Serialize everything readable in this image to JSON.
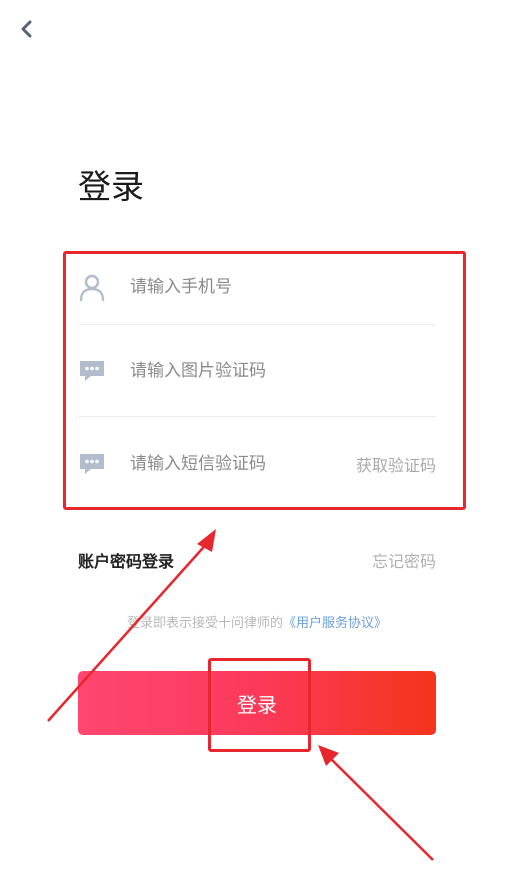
{
  "colors": {
    "accent_start": "#ff4670",
    "accent_end": "#f5341c",
    "annotation": "#e8262d",
    "link": "#6a9fe0"
  },
  "header": {
    "back_icon": "chevron-left-icon"
  },
  "title": "登录",
  "form": {
    "phone": {
      "placeholder": "请输入手机号",
      "icon": "user-icon"
    },
    "image_code": {
      "placeholder": "请输入图片验证码",
      "icon": "chat-icon"
    },
    "sms_code": {
      "placeholder": "请输入短信验证码",
      "icon": "chat-icon",
      "action": "获取验证码"
    }
  },
  "links": {
    "password_login": "账户密码登录",
    "forgot_password": "忘记密码"
  },
  "agreement": {
    "prefix": "登录即表示接受十问律师的",
    "link": "《用户服务协议》"
  },
  "login_button": "登录"
}
